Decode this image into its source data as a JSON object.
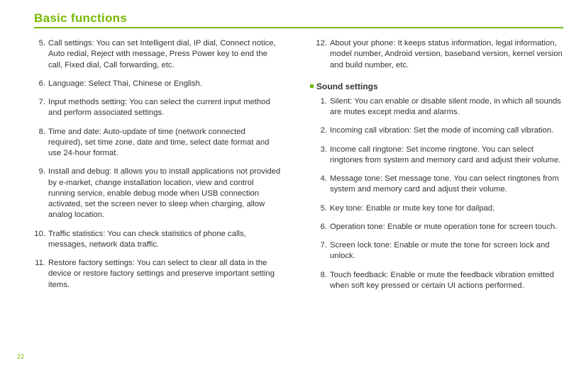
{
  "title": "Basic functions",
  "page_number": "22",
  "left": [
    {
      "n": "5.",
      "t": "Call settings: You can set Intelligent dial, IP dial, Connect notice, Auto redial, Reject with message, Press Power key to end the call, Fixed dial, Call forwarding, etc."
    },
    {
      "n": "6.",
      "t": "Language: Select Thai, Chinese or English."
    },
    {
      "n": "7.",
      "t": "Input methods setting: You can select the current input method and perform associated settings."
    },
    {
      "n": "8.",
      "t": "Time and date: Auto-update of time (network connected required), set time zone, date and time, select date format and use 24-hour format."
    },
    {
      "n": "9.",
      "t": "Install and debug: It allows you to install applications not provided by e-market, change installation location, view and control running service, enable debug mode when USB connection activated, set the screen never to sleep when charging, allow analog location."
    },
    {
      "n": "10.",
      "t": "Traffic statistics: You can check statistics of phone calls, messages, network data traffic."
    },
    {
      "n": "11.",
      "t": "Restore factory settings: You can select to clear all data in the device or restore factory settings and preserve important setting items."
    }
  ],
  "right_top": [
    {
      "n": "12.",
      "t": "About your phone: It keeps status information, legal information, model number, Android version, baseband version, kernel version and build number, etc."
    }
  ],
  "sound_heading": "Sound settings",
  "sound": [
    {
      "n": "1.",
      "t": "Silent: You can enable or disable silent mode, in which all sounds are mutes except media and alarms."
    },
    {
      "n": "2.",
      "t": "Incoming call vibration: Set the mode of incoming call vibration."
    },
    {
      "n": "3.",
      "t": "Income call ringtone: Set income ringtone. You can select ringtones from system and memory card and adjust their volume."
    },
    {
      "n": "4.",
      "t": "Message tone: Set message tone. You can select ringtones from system and memory card and adjust their volume."
    },
    {
      "n": "5.",
      "t": "Key tone: Enable or mute key tone for dailpad."
    },
    {
      "n": "6.",
      "t": "Operation tone: Enable or mute operation tone for screen touch."
    },
    {
      "n": "7.",
      "t": "Screen lock tone: Enable or mute the tone for screen lock and unlock."
    },
    {
      "n": "8.",
      "t": "Touch feedback: Enable or mute the feedback vibration emitted when soft key pressed or certain UI actions performed."
    }
  ]
}
